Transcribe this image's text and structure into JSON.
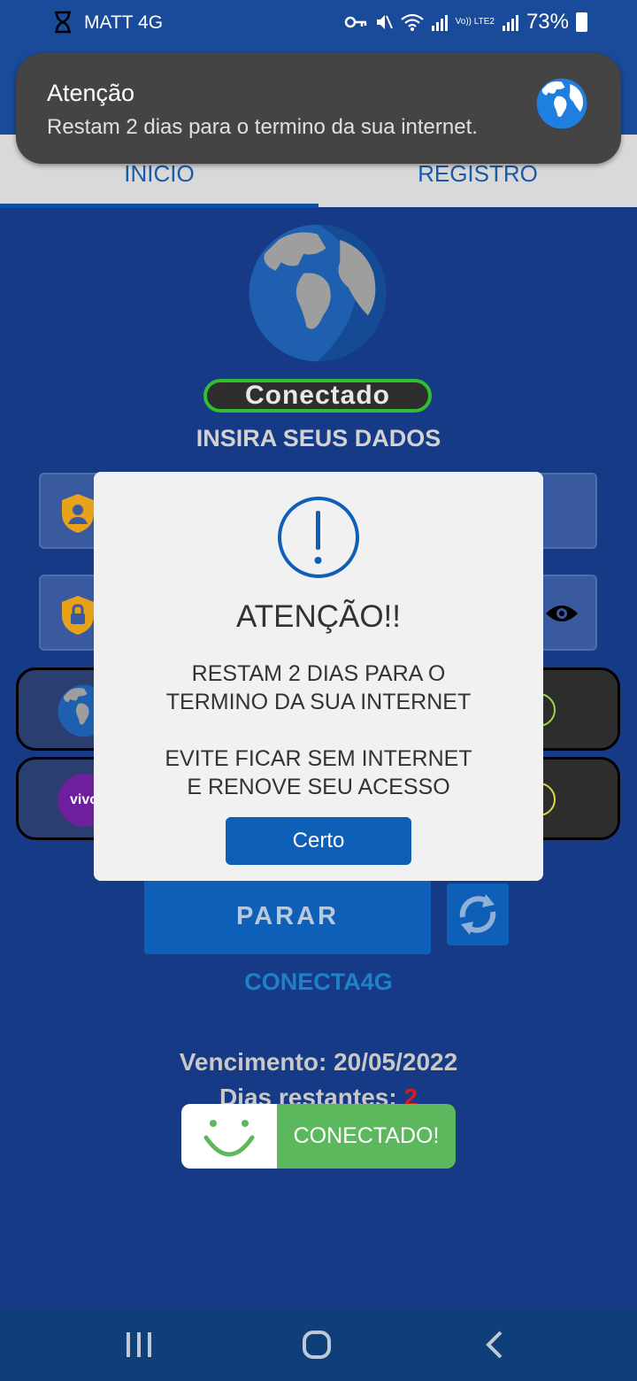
{
  "status_bar": {
    "carrier": "MATT 4G",
    "battery": "73%",
    "lte_label": "Vo)) LTE2",
    "icons": [
      "hourglass-icon",
      "key-icon",
      "mute-icon",
      "wifi-icon",
      "signal-icon",
      "battery-icon"
    ]
  },
  "tabs": [
    {
      "label": "INICIO",
      "active": true
    },
    {
      "label": "REGISTRO",
      "active": false
    }
  ],
  "main": {
    "status_pill": "Conectado",
    "heading": "INSIRA SEUS DADOS",
    "stop_button": "PARAR",
    "app_name": "CONECTA4G",
    "expiry_label": "Vencimento: 20/05/2022",
    "days_label": "Dias restantes: ",
    "days_value": "2",
    "server_rows": [
      {
        "icon": "globe-icon"
      },
      {
        "icon": "vivo-logo",
        "label": "vivo"
      }
    ]
  },
  "notification": {
    "title": "Atenção",
    "text": "Restam 2 dias para o termino da sua internet."
  },
  "dialog": {
    "title": "ATENÇÃO!!",
    "message": "RESTAM 2 DIAS PARA O\nTERMINO DA SUA INTERNET\n\nEVITE FICAR SEM INTERNET\nE RENOVE SEU ACESSO",
    "button": "Certo"
  },
  "toast": {
    "text": "CONECTADO!"
  },
  "colors": {
    "background": "#163a86",
    "primary_button": "#0e5fb8",
    "success": "#5cb85c",
    "danger": "#d81b1b"
  }
}
